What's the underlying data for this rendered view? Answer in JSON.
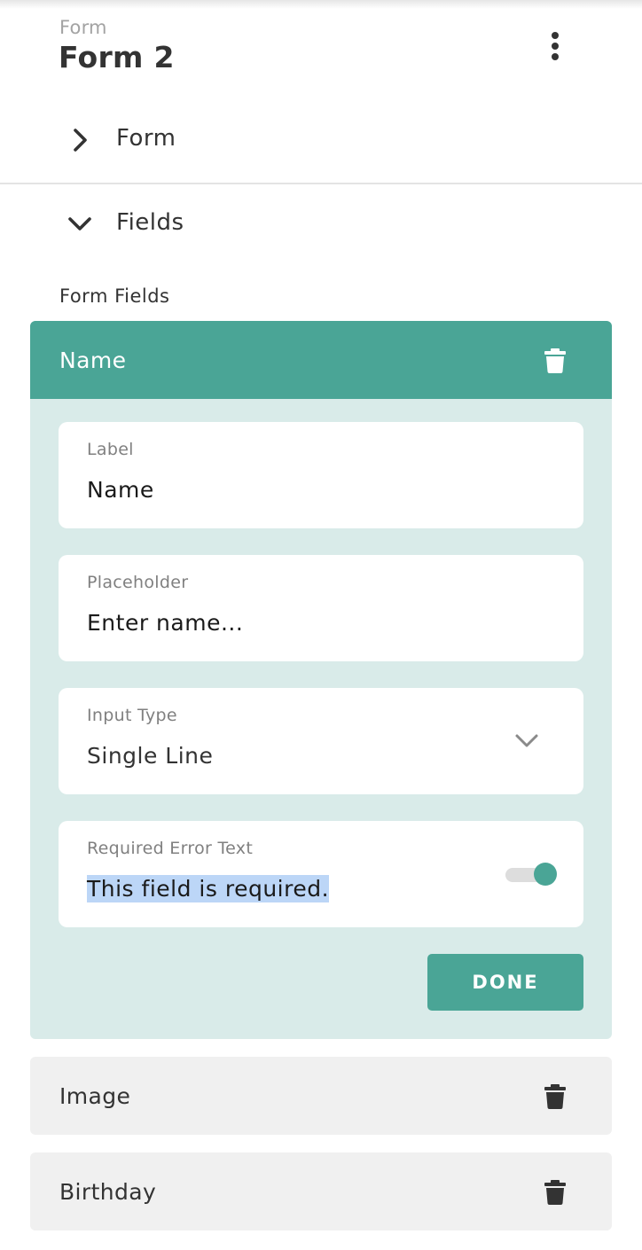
{
  "header": {
    "kicker": "Form",
    "title": "Form 2",
    "more_icon": "more-vertical-icon"
  },
  "sections": {
    "form": {
      "label": "Form",
      "state": "collapsed",
      "icon": "chevron-right-icon"
    },
    "fields": {
      "label": "Fields",
      "state": "expanded",
      "icon": "chevron-down-icon"
    }
  },
  "form_fields": {
    "heading": "Form Fields",
    "active": {
      "title": "Name",
      "delete_icon": "trash-icon",
      "label": {
        "caption": "Label",
        "value": "Name"
      },
      "placeholder": {
        "caption": "Placeholder",
        "value": "Enter name..."
      },
      "input_type": {
        "caption": "Input Type",
        "value": "Single Line",
        "icon": "chevron-down-icon"
      },
      "required": {
        "caption": "Required Error Text",
        "value": "This field is required.",
        "toggle_on": true
      },
      "done_label": "DONE"
    },
    "collapsed": [
      {
        "title": "Image",
        "delete_icon": "trash-icon"
      },
      {
        "title": "Birthday",
        "delete_icon": "trash-icon"
      }
    ]
  },
  "colors": {
    "accent": "#4aa596",
    "active_card_bg": "#d9ebe9",
    "collapsed_card_bg": "#f0f0f0",
    "text_primary": "#333333",
    "text_muted": "#808080",
    "selection": "#bcd6f7"
  }
}
